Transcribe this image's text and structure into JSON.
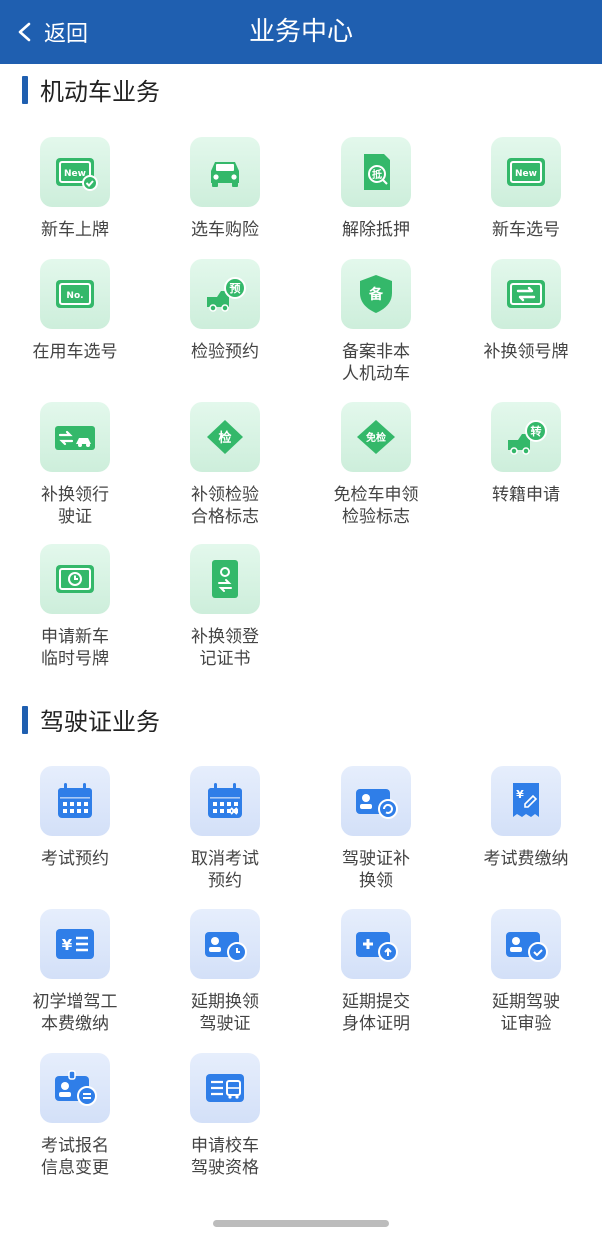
{
  "header": {
    "back_label": "返回",
    "title": "业务中心"
  },
  "colors": {
    "primary": "#1f5fb0",
    "green_icon": "#34b86a",
    "blue_icon": "#2f7ee8"
  },
  "sections": [
    {
      "title": "机动车业务",
      "items": [
        {
          "label": "新车上牌",
          "icon": "new-plate-check-icon",
          "glyph": "New"
        },
        {
          "label": "选车购险",
          "icon": "car-front-icon",
          "glyph": ""
        },
        {
          "label": "解除抵押",
          "icon": "mortgage-release-icon",
          "glyph": "抵"
        },
        {
          "label": "新车选号",
          "icon": "new-plate-icon",
          "glyph": "New"
        },
        {
          "label": "在用车选号",
          "icon": "plate-number-icon",
          "glyph": "No."
        },
        {
          "label": "检验预约",
          "icon": "truck-reserve-icon",
          "glyph": "预"
        },
        {
          "label": "备案非本\n人机动车",
          "icon": "shield-filing-icon",
          "glyph": "备"
        },
        {
          "label": "补换领号牌",
          "icon": "plate-exchange-icon",
          "glyph": "⇆"
        },
        {
          "label": "补换领行\n驶证",
          "icon": "license-exchange-icon",
          "glyph": "⇆"
        },
        {
          "label": "补领检验\n合格标志",
          "icon": "inspection-diamond-icon",
          "glyph": "检"
        },
        {
          "label": "免检车申领\n检验标志",
          "icon": "exempt-diamond-icon",
          "glyph": "免检"
        },
        {
          "label": "转籍申请",
          "icon": "truck-transfer-icon",
          "glyph": "转"
        },
        {
          "label": "申请新车\n临时号牌",
          "icon": "temp-plate-clock-icon",
          "glyph": ""
        },
        {
          "label": "补换领登\n记证书",
          "icon": "certificate-book-icon",
          "glyph": ""
        }
      ]
    },
    {
      "title": "驾驶证业务",
      "items": [
        {
          "label": "考试预约",
          "icon": "calendar-icon",
          "glyph": ""
        },
        {
          "label": "取消考试\n预约",
          "icon": "calendar-cancel-icon",
          "glyph": ""
        },
        {
          "label": "驾驶证补\n换领",
          "icon": "id-card-refresh-icon",
          "glyph": ""
        },
        {
          "label": "考试费缴纳",
          "icon": "receipt-fee-icon",
          "glyph": "¥"
        },
        {
          "label": "初学增驾工\n本费缴纳",
          "icon": "yen-list-icon",
          "glyph": "¥"
        },
        {
          "label": "延期换领\n驾驶证",
          "icon": "id-card-clock-icon",
          "glyph": ""
        },
        {
          "label": "延期提交\n身体证明",
          "icon": "medical-card-icon",
          "glyph": ""
        },
        {
          "label": "延期驾驶\n证审验",
          "icon": "id-card-check-icon",
          "glyph": ""
        },
        {
          "label": "考试报名\n信息变更",
          "icon": "badge-edit-icon",
          "glyph": ""
        },
        {
          "label": "申请校车\n驾驶资格",
          "icon": "school-bus-icon",
          "glyph": ""
        }
      ]
    }
  ]
}
